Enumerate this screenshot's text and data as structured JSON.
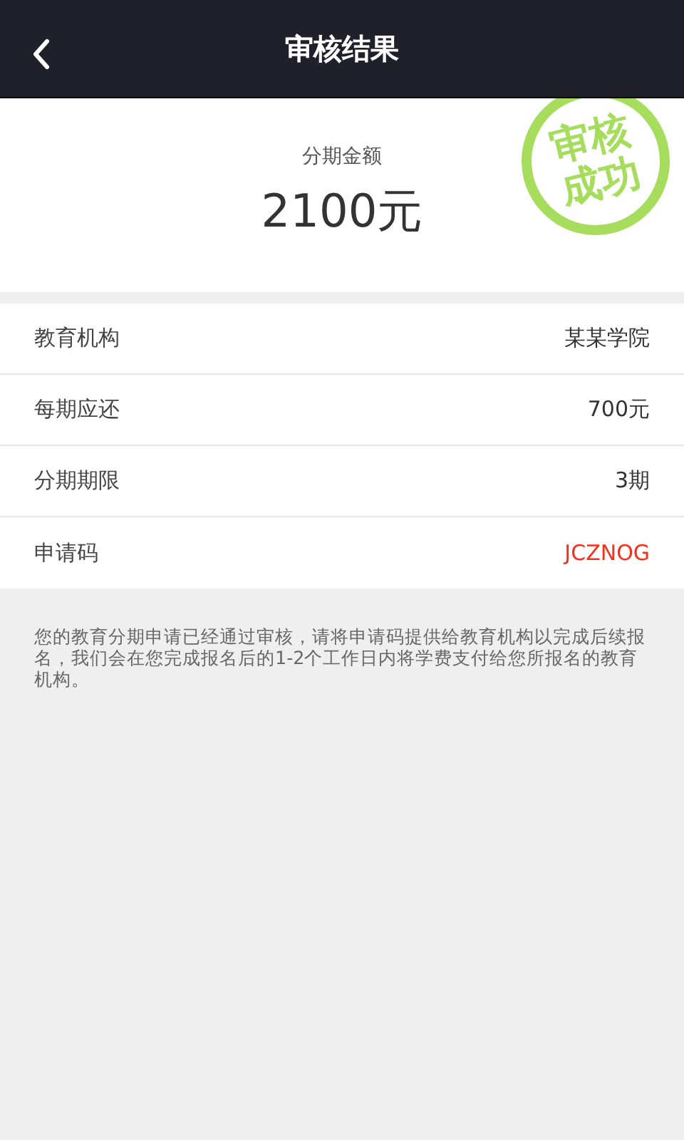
{
  "header": {
    "title": "审核结果"
  },
  "summary": {
    "label": "分期金额",
    "amount": "2100元",
    "stamp": [
      "审核",
      "成功"
    ]
  },
  "rows": [
    {
      "label": "教育机构",
      "value": "某某学院",
      "kind": "plain"
    },
    {
      "label": "每期应还",
      "value": "700元",
      "kind": "plain"
    },
    {
      "label": "分期期限",
      "value": "3期",
      "kind": "plain"
    },
    {
      "label": "申请码",
      "value": "JCZNOG",
      "kind": "code"
    }
  ],
  "notice": "您的教育分期申请已经通过审核，请将申请码提供给教育机构以完成后续报名，我们会在您完成报名后的1-2个工作日内将学费支付给您所报名的教育机构。"
}
